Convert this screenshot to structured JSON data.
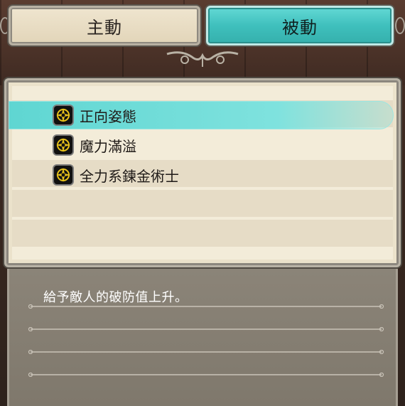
{
  "tabs": {
    "active_label": "主動",
    "passive_label": "被動"
  },
  "skills": [
    {
      "name": "正向姿態",
      "icon": "compass-star-icon",
      "selected": true
    },
    {
      "name": "魔力滿溢",
      "icon": "compass-star-icon",
      "selected": false
    },
    {
      "name": "全力系鍊金術士",
      "icon": "compass-star-icon",
      "selected": false
    }
  ],
  "description": "給予敵人的破防值上升。",
  "colors": {
    "selected_tab": "#3fc0bd",
    "panel": "#ebe2cb",
    "icon_gold": "#e8c21a"
  }
}
